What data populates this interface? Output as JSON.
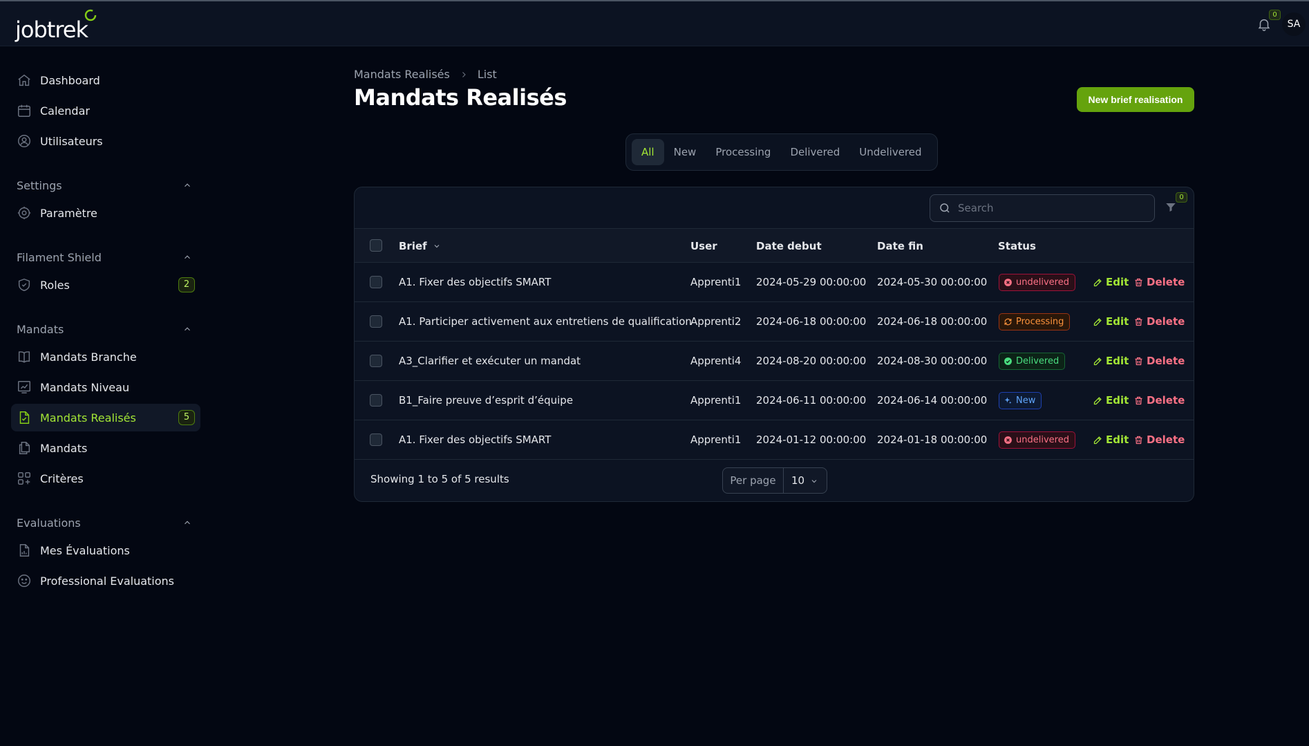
{
  "app": {
    "logo_text": "jobtrek",
    "notifications_count": "0",
    "user_initials": "SA"
  },
  "sidebar": {
    "top_items": [
      {
        "label": "Dashboard",
        "icon": "home-icon"
      },
      {
        "label": "Calendar",
        "icon": "calendar-icon"
      },
      {
        "label": "Utilisateurs",
        "icon": "user-circle-icon"
      }
    ],
    "groups": [
      {
        "label": "Settings",
        "items": [
          {
            "label": "Paramètre",
            "icon": "cog-icon"
          }
        ]
      },
      {
        "label": "Filament Shield",
        "items": [
          {
            "label": "Roles",
            "icon": "shield-icon",
            "badge": "2"
          }
        ]
      },
      {
        "label": "Mandats",
        "items": [
          {
            "label": "Mandats Branche",
            "icon": "book-icon"
          },
          {
            "label": "Mandats Niveau",
            "icon": "chart-icon"
          },
          {
            "label": "Mandats Realisés",
            "icon": "document-check-icon",
            "badge": "5",
            "active": true
          },
          {
            "label": "Mandats",
            "icon": "documents-icon"
          },
          {
            "label": "Critères",
            "icon": "squares-plus-icon"
          }
        ]
      },
      {
        "label": "Evaluations",
        "items": [
          {
            "label": "Mes Évaluations",
            "icon": "document-chart-icon"
          },
          {
            "label": "Professional Evaluations",
            "icon": "face-smile-icon"
          }
        ]
      }
    ]
  },
  "breadcrumb": {
    "parent": "Mandats Realisés",
    "current": "List"
  },
  "page": {
    "title": "Mandats Realisés",
    "primary_action": "New brief realisation"
  },
  "tabs": [
    "All",
    "New",
    "Processing",
    "Delivered",
    "Undelivered"
  ],
  "table": {
    "search_placeholder": "Search",
    "filter_count": "0",
    "columns": {
      "brief": "Brief",
      "user": "User",
      "date_debut": "Date debut",
      "date_fin": "Date fin",
      "status": "Status"
    },
    "rows": [
      {
        "brief": "A1. Fixer des objectifs SMART",
        "user": "Apprenti1",
        "date_debut": "2024-05-29 00:00:00",
        "date_fin": "2024-05-30 00:00:00",
        "status": "undelivered"
      },
      {
        "brief": "A1. Participer activement aux entretiens de qualification",
        "user": "Apprenti2",
        "date_debut": "2024-06-18 00:00:00",
        "date_fin": "2024-06-18 00:00:00",
        "status": "Processing"
      },
      {
        "brief": "A3_Clarifier et exécuter un mandat",
        "user": "Apprenti4",
        "date_debut": "2024-08-20 00:00:00",
        "date_fin": "2024-08-30 00:00:00",
        "status": "Delivered"
      },
      {
        "brief": "B1_Faire preuve d’esprit d’équipe",
        "user": "Apprenti1",
        "date_debut": "2024-06-11 00:00:00",
        "date_fin": "2024-06-14 00:00:00",
        "status": "New"
      },
      {
        "brief": "A1. Fixer des objectifs SMART",
        "user": "Apprenti1",
        "date_debut": "2024-01-12 00:00:00",
        "date_fin": "2024-01-18 00:00:00",
        "status": "undelivered"
      }
    ],
    "actions": {
      "edit": "Edit",
      "delete": "Delete"
    },
    "footer": {
      "showing": "Showing 1 to 5 of 5 results",
      "per_page_label": "Per page",
      "per_page_value": "10"
    }
  },
  "colors": {
    "accent": "#65a30d",
    "accent_text": "#a3e635",
    "danger": "#fb7185",
    "background": "#030712"
  }
}
